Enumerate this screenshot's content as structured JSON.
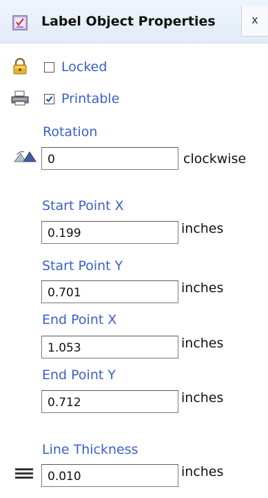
{
  "panel": {
    "title": "Label Object Properties",
    "close_label": "x"
  },
  "locked": {
    "label": "Locked",
    "checked": false
  },
  "printable": {
    "label": "Printable",
    "checked": true
  },
  "rotation": {
    "label": "Rotation",
    "value": "0",
    "unit": "clockwise"
  },
  "start_x": {
    "label": "Start Point X",
    "value": "0.199",
    "unit": "inches"
  },
  "start_y": {
    "label": "Start Point Y",
    "value": "0.701",
    "unit": "inches"
  },
  "end_x": {
    "label": "End Point X",
    "value": "1.053",
    "unit": "inches"
  },
  "end_y": {
    "label": "End Point Y",
    "value": "0.712",
    "unit": "inches"
  },
  "thickness": {
    "label": "Line Thickness",
    "value": "0.010",
    "unit": "inches"
  },
  "colors": {
    "label_blue": "#3a5fcd",
    "header_bg": "#e2ecf7"
  },
  "icons": {
    "title": "label-properties-icon",
    "locked": "padlock-icon",
    "printable": "printer-icon",
    "rotation": "rotation-icon",
    "thickness": "line-thickness-icon"
  }
}
